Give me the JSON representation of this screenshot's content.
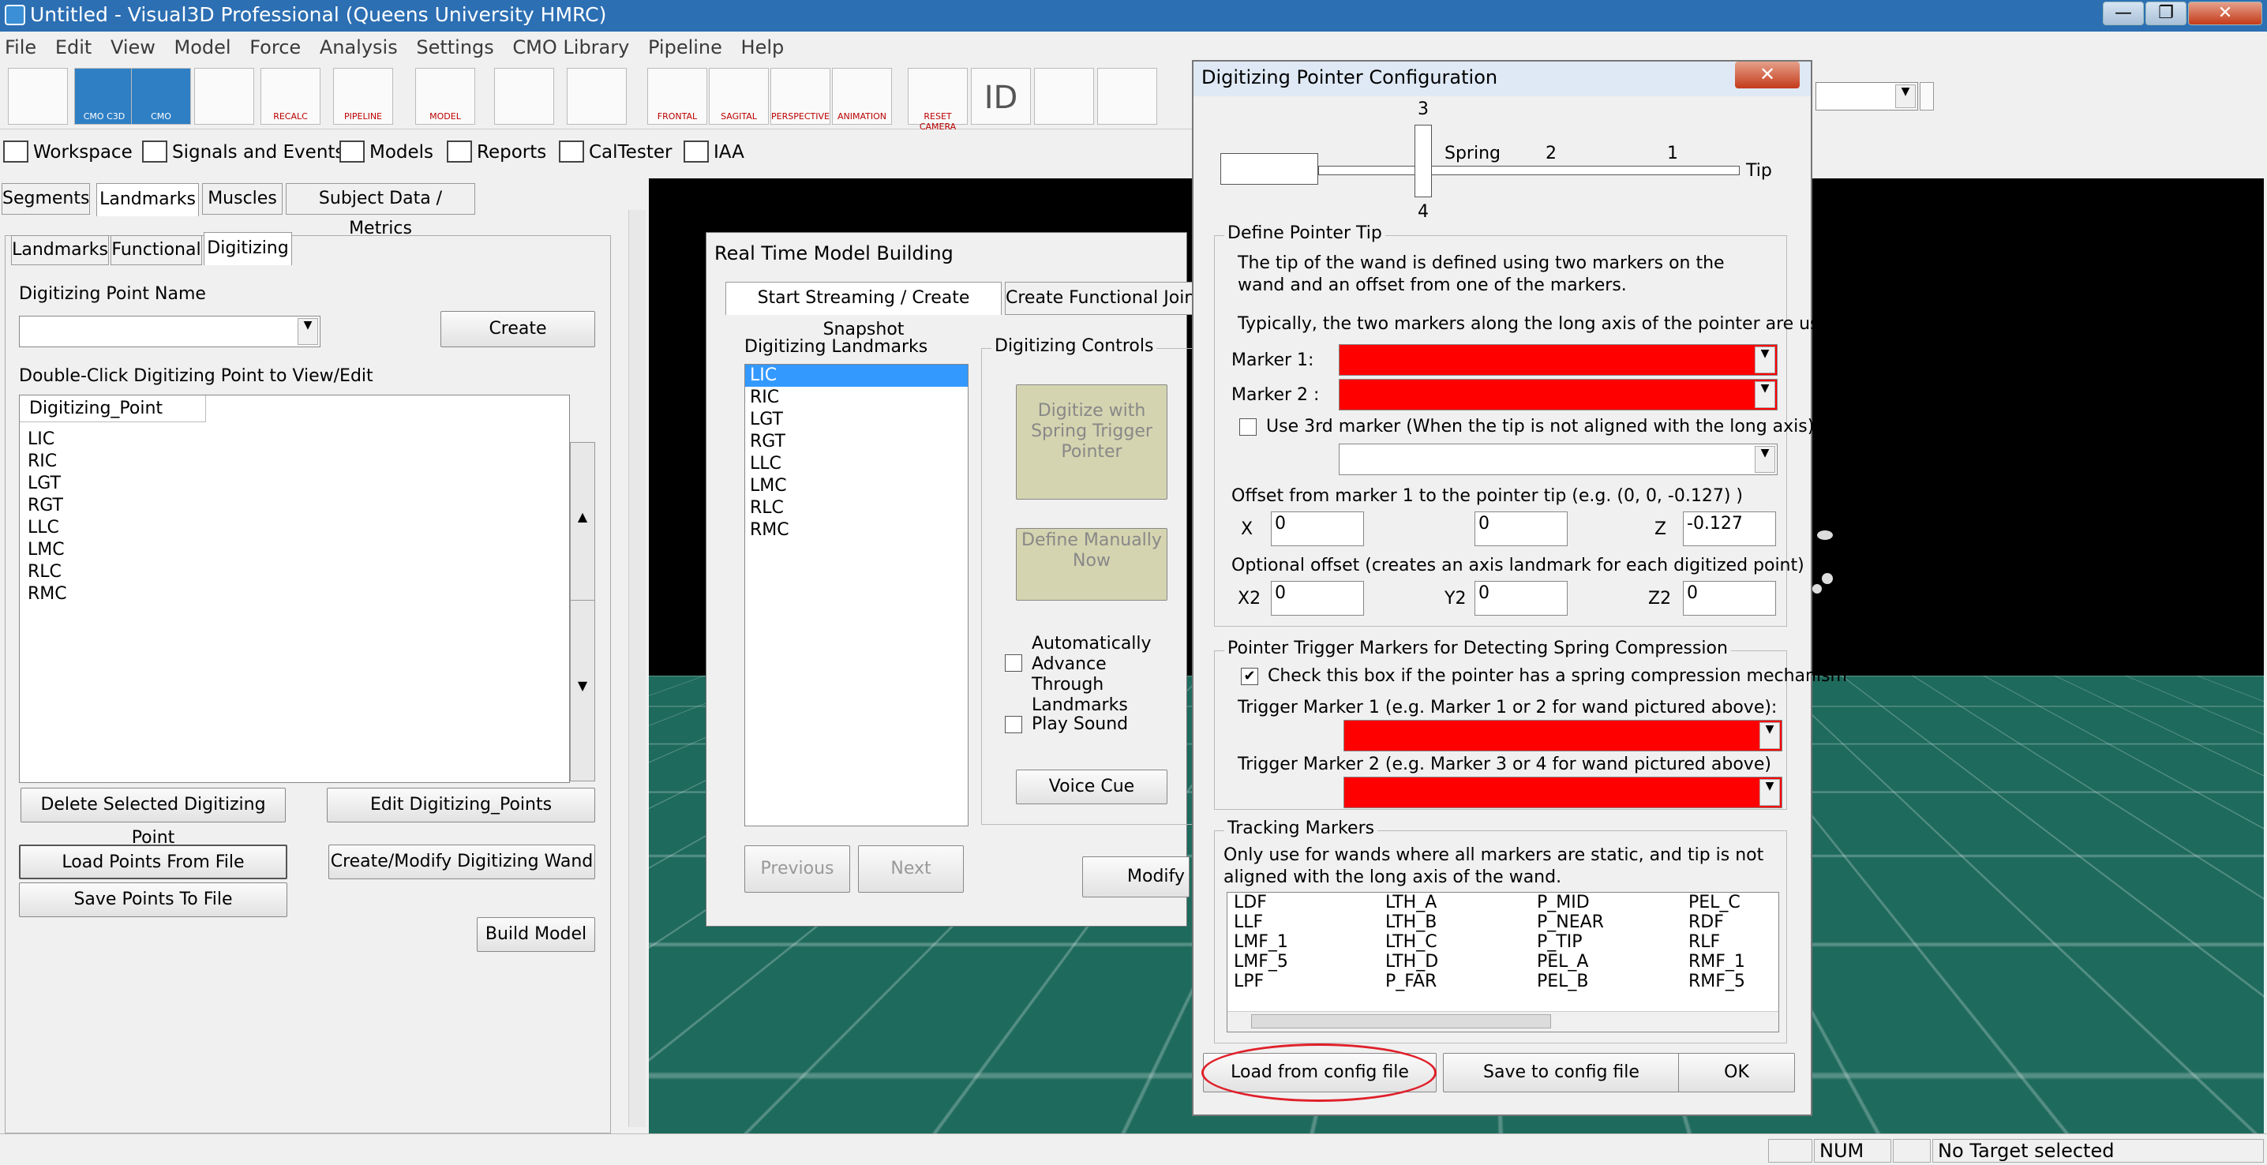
{
  "window": {
    "title": "Untitled - Visual3D Professional (Queens University HMRC)",
    "min": "—",
    "max": "❐",
    "close": "✕"
  },
  "menu": [
    "File",
    "Edit",
    "View",
    "Model",
    "Force",
    "Analysis",
    "Settings",
    "CMO Library",
    "Pipeline",
    "Help"
  ],
  "toolbar": {
    "cmo_c3d": "CMO C3D",
    "cmo": "CMO",
    "recalc": "RECALC",
    "pipeline": "PIPELINE",
    "model": "MODEL",
    "frontal": "FRONTAL",
    "sagital": "SAGITAL",
    "perspective": "PERSPECTIVE",
    "animation": "ANIMATION",
    "reset": "RESET CAMERA",
    "id": "ID"
  },
  "tabs": [
    "Workspace",
    "Signals and Events",
    "Models",
    "Reports",
    "CalTester",
    "IAA"
  ],
  "left": {
    "tabs": [
      "Segments",
      "Landmarks",
      "Muscles",
      "Subject Data / Metrics"
    ],
    "subtabs": [
      "Landmarks",
      "Functional",
      "Digitizing"
    ],
    "point_name_label": "Digitizing Point Name",
    "create": "Create",
    "dblclick_label": "Double-Click Digitizing Point to View/Edit",
    "col": "Digitizing_Point",
    "points": [
      "LIC",
      "RIC",
      "LGT",
      "RGT",
      "LLC",
      "LMC",
      "RLC",
      "RMC"
    ],
    "delete": "Delete Selected Digitizing Point",
    "edit": "Edit Digitizing_Points",
    "load": "Load Points From File",
    "wand": "Create/Modify Digitizing Wand",
    "save": "Save Points To File",
    "build": "Build Model"
  },
  "rt": {
    "title": "Real Time Model Building",
    "tab1": "Start Streaming / Create Snapshot",
    "tab2": "Create Functional Joints",
    "landmarks_label": "Digitizing Landmarks",
    "landmarks": [
      "LIC",
      "RIC",
      "LGT",
      "RGT",
      "LLC",
      "LMC",
      "RLC",
      "RMC"
    ],
    "controls_label": "Digitizing Controls",
    "digitize_btn": "Digitize with Spring Trigger Pointer",
    "define_btn": "Define Manually Now",
    "auto": "Automatically Advance Through Landmarks",
    "sound": "Play Sound",
    "voice": "Voice Cue",
    "prev": "Previous",
    "next": "Next",
    "modify": "Modify D"
  },
  "dp": {
    "title": "Digitizing Pointer Configuration",
    "wand": {
      "n3": "3",
      "n4": "4",
      "spring": "Spring",
      "n2": "2",
      "n1": "1",
      "tip": "Tip"
    },
    "define_tip": "Define Pointer Tip",
    "desc1": "The tip of the wand is defined using two markers on the wand and an offset from one of the markers.",
    "desc2": "Typically, the two markers along the long axis of the pointer are used.",
    "marker1": "Marker 1:",
    "marker2": "Marker 2 :",
    "use3rd": "Use 3rd marker  (When the tip is not aligned with the long axis)",
    "offset_label": "Offset from marker 1 to the pointer tip (e.g. (0, 0, -0.127) )",
    "x": "X",
    "y": "Y",
    "z": "Z",
    "xv": "0",
    "yv": "0",
    "zv": "-0.127",
    "opt_label": "Optional offset (creates an axis landmark for each digitized point)",
    "x2": "X2",
    "y2": "Y2",
    "z2": "Z2",
    "x2v": "0",
    "y2v": "0",
    "z2v": "0",
    "trigger_group": "Pointer Trigger Markers for Detecting Spring Compression",
    "check_spring": "Check this box if the pointer has a spring compression mechanism",
    "trig1": "Trigger Marker 1   (e.g. Marker 1 or 2 for wand pictured above):",
    "trig2": "Trigger Marker 2   (e.g. Marker 3 or 4 for wand pictured above)",
    "tracking": "Tracking Markers",
    "tracking_desc": "Only use for wands where all markers are static, and tip is not aligned with the long axis of the wand.",
    "markers": [
      [
        "LDF",
        "LTH_A",
        "P_MID",
        "PEL_C"
      ],
      [
        "LLF",
        "LTH_B",
        "P_NEAR",
        "RDF"
      ],
      [
        "LMF_1",
        "LTH_C",
        "P_TIP",
        "RLF"
      ],
      [
        "LMF_5",
        "LTH_D",
        "PEL_A",
        "RMF_1"
      ],
      [
        "LPF",
        "P_FAR",
        "PEL_B",
        "RMF_5"
      ]
    ],
    "load_cfg": "Load from config file",
    "save_cfg": "Save to config file",
    "ok": "OK"
  },
  "status": {
    "num": "NUM",
    "target": "No Target selected"
  }
}
